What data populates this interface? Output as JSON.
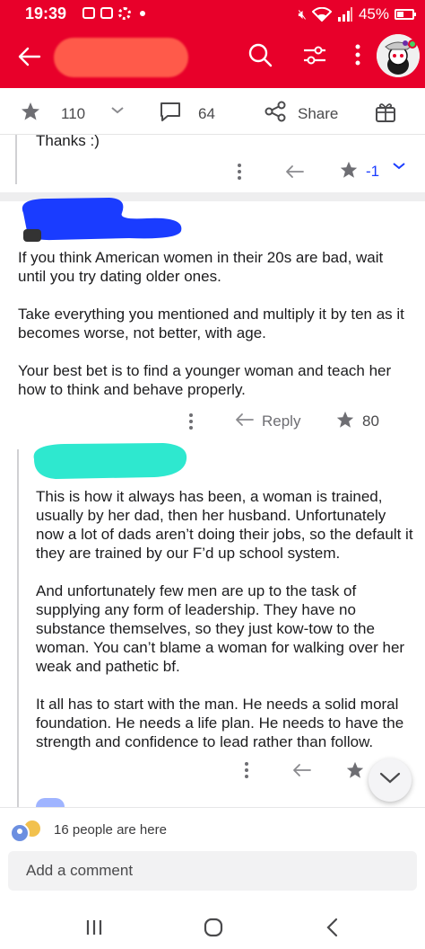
{
  "status_bar": {
    "time": "19:39",
    "battery": "45%"
  },
  "post_bar": {
    "votes": "110",
    "comments": "64",
    "share_label": "Share"
  },
  "comments": [
    {
      "text": [
        "Thanks :)"
      ],
      "score": "-1"
    },
    {
      "text": [
        "If you think American women in their 20s are bad, wait until you try dating older ones.",
        "Take everything you mentioned and multiply it by ten as it becomes worse, not better, with age.",
        "Your best bet is to find a younger woman and teach her how to think and behave properly."
      ],
      "reply_label": "Reply",
      "score": "80"
    },
    {
      "text": [
        "This is how it always has been, a woman is trained, usually by her dad, then her husband. Unfortunately now a lot of dads aren’t doing their jobs, so the default it they are trained by our F’d up school system.",
        "And unfortunately few men are up to the task of supplying any form of leadership. They have no substance themselves, so they just kow-tow to the woman. You can’t blame a woman for walking over her weak and pathetic bf.",
        "It all has to start with the man. He needs a solid moral foundation. He needs a life plan. He needs to have the strength and confidence to lead rather than follow."
      ]
    }
  ],
  "presence": {
    "text": "16 people are here"
  },
  "comment_input": {
    "placeholder": "Add a comment"
  },
  "colors": {
    "header": "#e8002a",
    "redact_title": "#ff5a4a",
    "redact_blue": "#1a3cff",
    "redact_teal": "#2ee8cf"
  }
}
